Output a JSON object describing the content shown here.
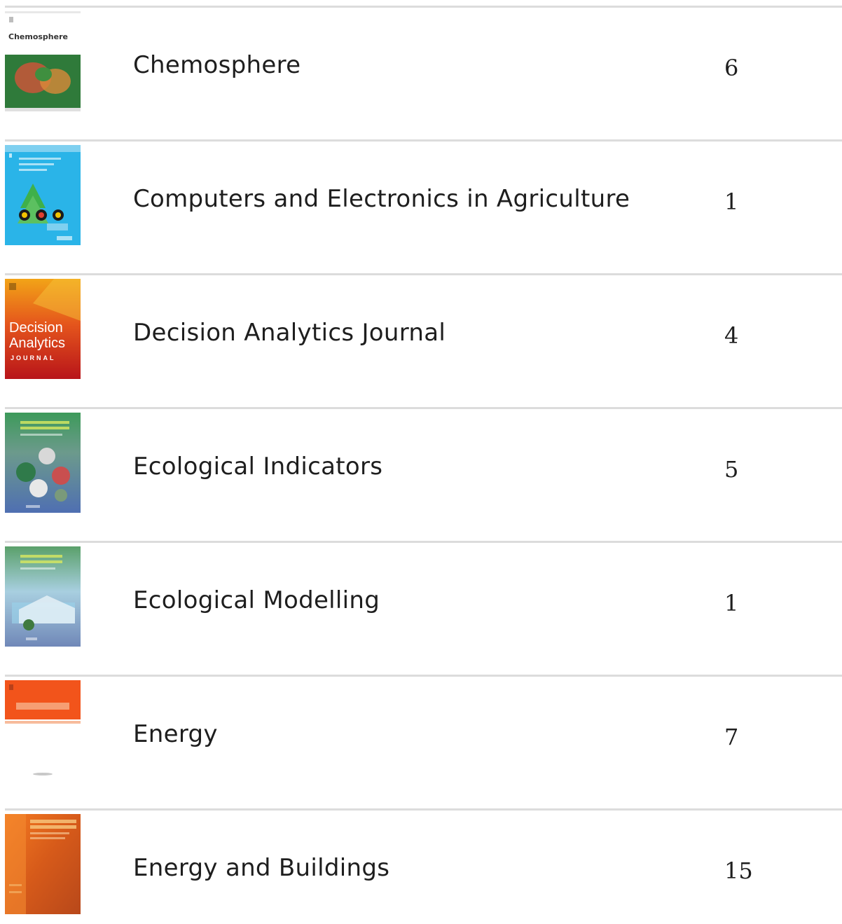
{
  "journals": [
    {
      "name": "Chemosphere",
      "count": "6",
      "cover_text": "Chemosphere",
      "cover_colors": [
        "#ffffff",
        "#2f7a3a",
        "#c9563a"
      ]
    },
    {
      "name": "Computers and Electronics in Agriculture",
      "count": "1",
      "cover_colors": [
        "#2ab4e8",
        "#7fd0f0",
        "#3fb04a"
      ]
    },
    {
      "name": "Decision Analytics Journal",
      "count": "4",
      "cover_text_1": "Decision",
      "cover_text_2": "Analytics",
      "cover_text_3": "JOURNAL",
      "cover_colors": [
        "#f2a417",
        "#d8231c",
        "#b8141a"
      ]
    },
    {
      "name": "Ecological Indicators",
      "count": "5",
      "cover_colors": [
        "#3d9a5a",
        "#4f6fb2",
        "#c94f4f"
      ]
    },
    {
      "name": "Ecological Modelling",
      "count": "1",
      "cover_colors": [
        "#5aa06a",
        "#7088b8",
        "#9ad0e8"
      ]
    },
    {
      "name": "Energy",
      "count": "7",
      "cover_colors": [
        "#f2541b",
        "#ffffff",
        "#f07a3a"
      ]
    },
    {
      "name": "Energy and Buildings",
      "count": "15",
      "cover_colors": [
        "#f47a20",
        "#d65a1a",
        "#b8481a"
      ]
    }
  ]
}
